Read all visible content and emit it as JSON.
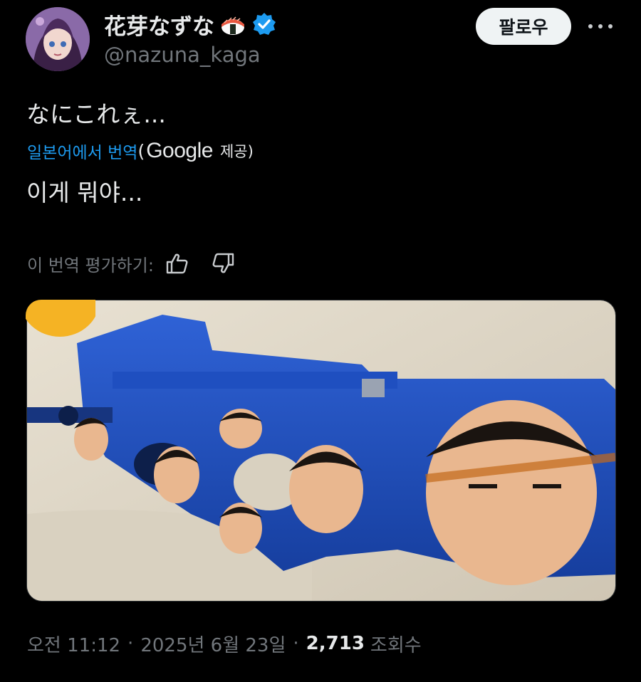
{
  "author": {
    "display_name": "花芽なずな",
    "handle": "@nazuna_kaga",
    "name_emoji": "sushi-icon",
    "verified_icon": "verified-badge-icon",
    "verified_color": "#1d9bf0"
  },
  "header": {
    "follow_label": "팔로우",
    "more_icon": "more-horizontal-icon"
  },
  "tweet": {
    "text": "なにこれぇ...",
    "translation_link": "일본어에서 번역",
    "translation_open": "(",
    "translation_provider": "Google",
    "translation_provided": "제공)",
    "translated_text": "이게 뭐야...",
    "rate_label": "이 번역 평가하기:",
    "thumbs_up_icon": "thumbs-up-icon",
    "thumbs_down_icon": "thumbs-down-icon"
  },
  "meta": {
    "time": "오전 11:12",
    "separator": "·",
    "date": "2025년 6월 23일",
    "views_count": "2,713",
    "views_label": "조회수"
  },
  "colors": {
    "background": "#000000",
    "text": "#e7e9ea",
    "muted": "#71767b",
    "link": "#1d9bf0",
    "follow_bg": "#eff3f4"
  }
}
